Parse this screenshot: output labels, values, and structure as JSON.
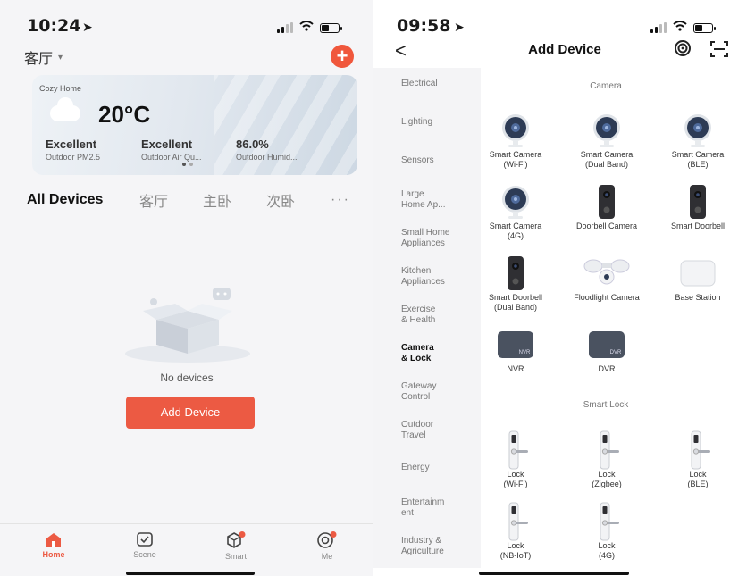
{
  "left": {
    "status_bar": {
      "time": "10:24"
    },
    "room_selector": {
      "label": "客厅",
      "caret": "▾"
    },
    "add_button": {
      "symbol": "+"
    },
    "weather": {
      "home_name": "Cozy Home",
      "temperature": "20°C",
      "stats": [
        {
          "value": "Excellent",
          "label": "Outdoor PM2.5"
        },
        {
          "value": "Excellent",
          "label": "Outdoor Air Qu..."
        },
        {
          "value": "86.0%",
          "label": "Outdoor Humid..."
        }
      ]
    },
    "room_tabs": [
      "All Devices",
      "客厅",
      "主卧",
      "次卧"
    ],
    "more": "···",
    "empty_text": "No devices",
    "add_device_button": "Add Device",
    "accent_color": "#ec5a43",
    "nav": [
      {
        "label": "Home",
        "icon": "home-icon"
      },
      {
        "label": "Scene",
        "icon": "scene-icon"
      },
      {
        "label": "Smart",
        "icon": "smart-icon"
      },
      {
        "label": "Me",
        "icon": "me-icon"
      }
    ]
  },
  "right": {
    "status_bar": {
      "time": "09:58"
    },
    "back": "<",
    "title": "Add Device",
    "categories": [
      "Electrical",
      "Lighting",
      "Sensors",
      "Large\nHome Ap...",
      "Small Home\nAppliances",
      "Kitchen\nAppliances",
      "Exercise\n& Health",
      "Camera\n& Lock",
      "Gateway\nControl",
      "Outdoor\nTravel",
      "Energy",
      "Entertainm\nent",
      "Industry &\nAgriculture"
    ],
    "active_category": "Camera\n& Lock",
    "sections": {
      "camera_title": "Camera",
      "camera_items": [
        {
          "name": "Smart Camera\n(Wi-Fi)",
          "icon": "camera-icon"
        },
        {
          "name": "Smart Camera\n(Dual Band)",
          "icon": "camera-icon"
        },
        {
          "name": "Smart Camera\n(BLE)",
          "icon": "camera-icon"
        },
        {
          "name": "Smart Camera\n(4G)",
          "icon": "camera-icon"
        },
        {
          "name": "Doorbell Camera",
          "icon": "doorbell-icon"
        },
        {
          "name": "Smart Doorbell",
          "icon": "doorbell-icon"
        },
        {
          "name": "Smart Doorbell\n(Dual Band)",
          "icon": "doorbell-icon"
        },
        {
          "name": "Floodlight Camera",
          "icon": "floodlight-icon"
        },
        {
          "name": "Base Station",
          "icon": "base-station-icon"
        },
        {
          "name": "NVR",
          "icon": "nvr-icon",
          "badge": "NVR"
        },
        {
          "name": "DVR",
          "icon": "dvr-icon",
          "badge": "DVR"
        }
      ],
      "lock_title": "Smart Lock",
      "lock_items": [
        {
          "name": "Lock\n(Wi-Fi)",
          "icon": "lock-icon"
        },
        {
          "name": "Lock\n(Zigbee)",
          "icon": "lock-icon"
        },
        {
          "name": "Lock\n(BLE)",
          "icon": "lock-icon"
        },
        {
          "name": "Lock\n(NB-IoT)",
          "icon": "lock-icon"
        },
        {
          "name": "Lock\n(4G)",
          "icon": "lock-icon"
        }
      ]
    }
  }
}
